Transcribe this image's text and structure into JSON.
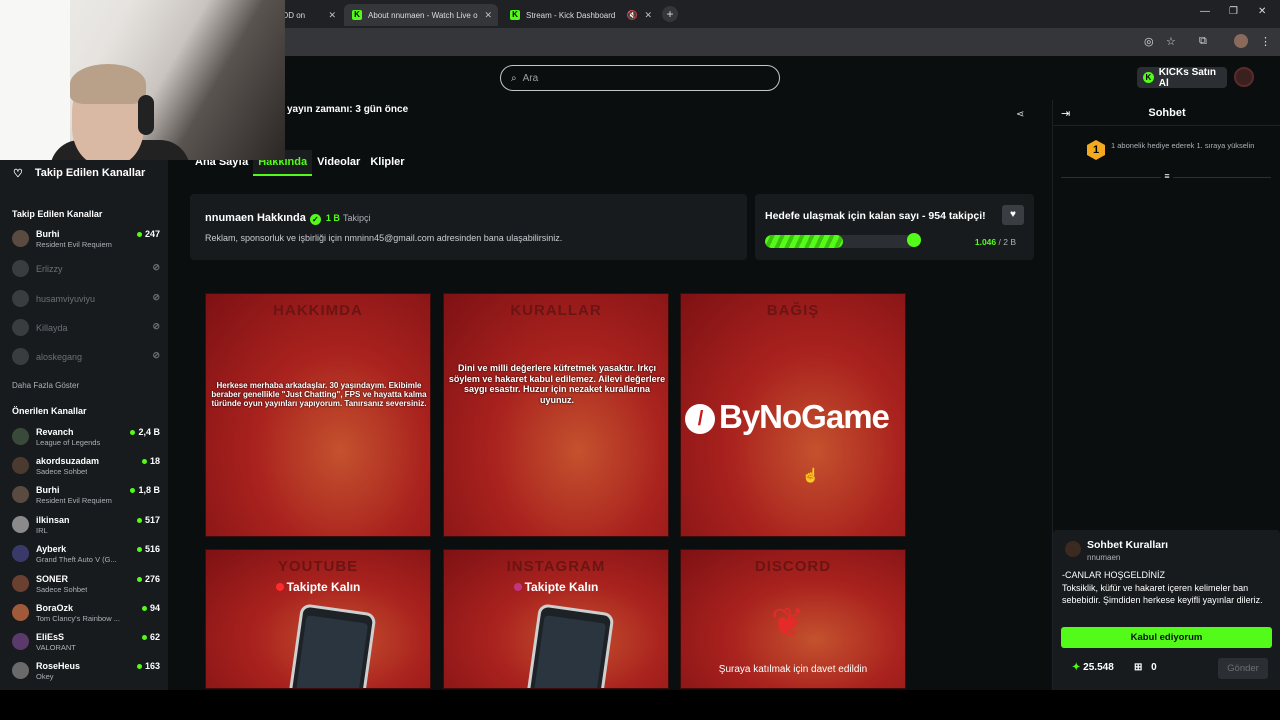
{
  "browser": {
    "tabs": [
      {
        "label": "e VOD on"
      },
      {
        "label": "About nnumaen - Watch Live o"
      },
      {
        "label": "Stream - Kick Dashboard"
      }
    ]
  },
  "header": {
    "search_placeholder": "Ara",
    "kicks_button": "KICKs Satın Al"
  },
  "sidebar": {
    "header": "Takip Edilen Kanallar",
    "followed_title": "Takip Edilen Kanallar",
    "followed": [
      {
        "name": "Burhi",
        "category": "Resident Evil Requiem",
        "viewers": "247"
      },
      {
        "name": "Erlizzy"
      },
      {
        "name": "husamviyuviyu"
      },
      {
        "name": "Killayda"
      },
      {
        "name": "aloskegang"
      }
    ],
    "show_more": "Daha Fazla Göster",
    "recommended_title": "Önerilen Kanallar",
    "recommended": [
      {
        "name": "Revanch",
        "category": "League of Legends",
        "viewers": "2,4 B"
      },
      {
        "name": "akordsuzadam",
        "category": "Sadece Sohbet",
        "viewers": "18"
      },
      {
        "name": "Burhi",
        "category": "Resident Evil Requiem",
        "viewers": "1,8 B"
      },
      {
        "name": "ilkinsan",
        "category": "IRL",
        "viewers": "517"
      },
      {
        "name": "Ayberk",
        "category": "Grand Theft Auto V (G...",
        "viewers": "516"
      },
      {
        "name": "SONER",
        "category": "Sadece Sohbet",
        "viewers": "276"
      },
      {
        "name": "BoraOzk",
        "category": "Tom Clancy's Rainbow ...",
        "viewers": "94"
      },
      {
        "name": "EliEsS",
        "category": "VALORANT",
        "viewers": "62"
      },
      {
        "name": "RoseHeus",
        "category": "Okey",
        "viewers": "163"
      }
    ]
  },
  "channel": {
    "last_live": "yayın zamanı: 3 gün önce",
    "tabs": [
      "Ana Sayfa",
      "Hakkında",
      "Videolar",
      "Klipler"
    ],
    "about_title": "nnumaen Hakkında",
    "followers": "1 B",
    "followers_label": "Takipçi",
    "about_desc": "Reklam, sponsorluk ve işbirliği için nmninn45@gmail.com adresinden bana ulaşabilirsiniz.",
    "goal_title": "Hedefe ulaşmak için kalan sayı - 954 takipçi!",
    "goal_current": "1.046",
    "goal_total": "/ 2 B",
    "goal_progress": 0.523
  },
  "panels": {
    "hakkimda_title": "HAKKIMDA",
    "hakkimda_text": "Herkese merhaba arkadaşlar. 30 yaşındayım. Ekibimle beraber genellikle \"Just Chatting\", FPS ve hayatta kalma türünde oyun yayınları yapıyorum. Tanırsanız seversiniz.",
    "kurallar_title": "KURALLAR",
    "kurallar_text": "Dini ve milli değerlere küfretmek yasaktır. Irkçı söylem ve hakaret kabul edilemez. Ailevi değerlere saygı esastır. Huzur için nezaket kurallarına uyunuz.",
    "bagis_title": "BAĞIŞ",
    "bagis_brand": "ByNoGame",
    "youtube_title": "YOUTUBE",
    "youtube_sub": "Takipte Kalın",
    "instagram_title": "INSTAGRAM",
    "instagram_sub": "Takipte Kalın",
    "discord_title": "DISCORD",
    "discord_text": "Şuraya katılmak için davet edildin"
  },
  "chat": {
    "title": "Sohbet",
    "sub_badge": "1",
    "sub_msg": "1 abonelik hediye ederek 1. sıraya yükselin",
    "rules_title": "Sohbet Kuralları",
    "rules_user": "nnumaen",
    "rules_line1": "-CANLAR HOŞGELDİNİZ",
    "rules_line2": "Toksiklik, küfür ve hakaret içeren kelimeler ban sebebidir. Şimdiden herkese keyifli yayınlar dileriz.",
    "accept_label": "Kabul ediyorum",
    "kick_balance": "25.548",
    "store_count": "0",
    "send_label": "Gönder"
  }
}
